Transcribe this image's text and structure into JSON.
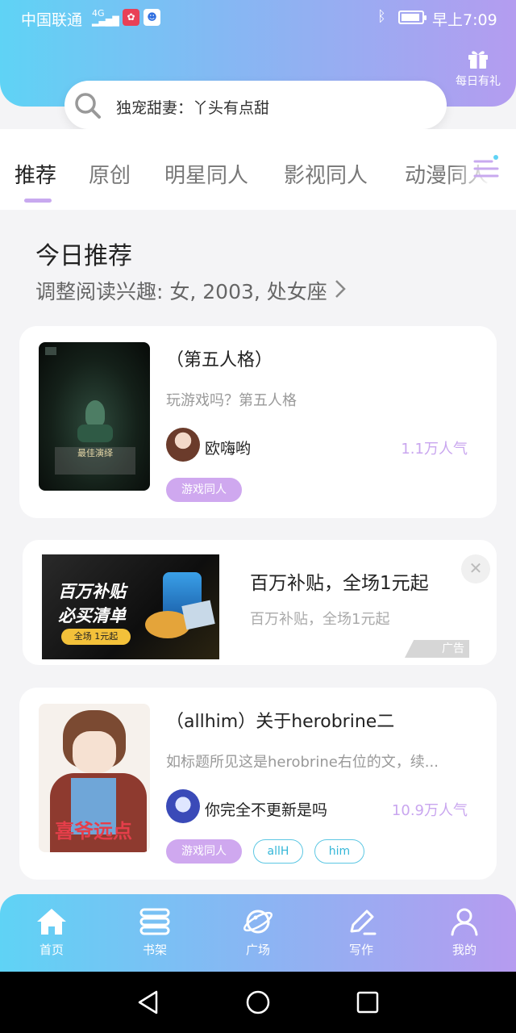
{
  "status_bar": {
    "carrier": "中国联通",
    "signal": "4G",
    "time": "早上7:09"
  },
  "header": {
    "gift_label": "每日有礼",
    "search_text": "独宠甜妻：丫头有点甜"
  },
  "tabs": [
    {
      "label": "推荐",
      "active": true
    },
    {
      "label": "原创"
    },
    {
      "label": "明星同人"
    },
    {
      "label": "影视同人"
    },
    {
      "label": "动漫同人"
    }
  ],
  "section": {
    "title": "今日推荐",
    "subtitle": "调整阅读兴趣: 女, 2003, 处女座"
  },
  "books": [
    {
      "title": "（第五人格）",
      "desc": "玩游戏吗？第五人格",
      "author": "欧嗨哟",
      "popularity": "1.1万人气",
      "tags": [
        "游戏同人"
      ],
      "cover_text": "最佳演绎"
    },
    {
      "title": "（allhim）关于herobrine二",
      "desc": "如标题所见这是herobrine右位的文，续...",
      "author": "你完全不更新是吗",
      "popularity": "10.9万人气",
      "tags": [
        "游戏同人",
        "allH",
        "him"
      ],
      "cover_text": "喜爷远点"
    }
  ],
  "ad": {
    "title": "百万补贴，全场1元起",
    "desc": "百万补贴，全场1元起",
    "badge": "广告",
    "image_line1": "百万补贴",
    "image_line2": "必买清单",
    "image_button": "全场 1元起"
  },
  "bottom_nav": [
    {
      "label": "首页",
      "icon": "home-icon"
    },
    {
      "label": "书架",
      "icon": "bookshelf-icon"
    },
    {
      "label": "广场",
      "icon": "planet-icon"
    },
    {
      "label": "写作",
      "icon": "pen-icon"
    },
    {
      "label": "我的",
      "icon": "user-icon"
    }
  ],
  "colors": {
    "gradient_start": "#5fd3f5",
    "gradient_end": "#b69bf0",
    "tag_fill": "#cfa8ef",
    "popularity": "#c9a6ef"
  }
}
